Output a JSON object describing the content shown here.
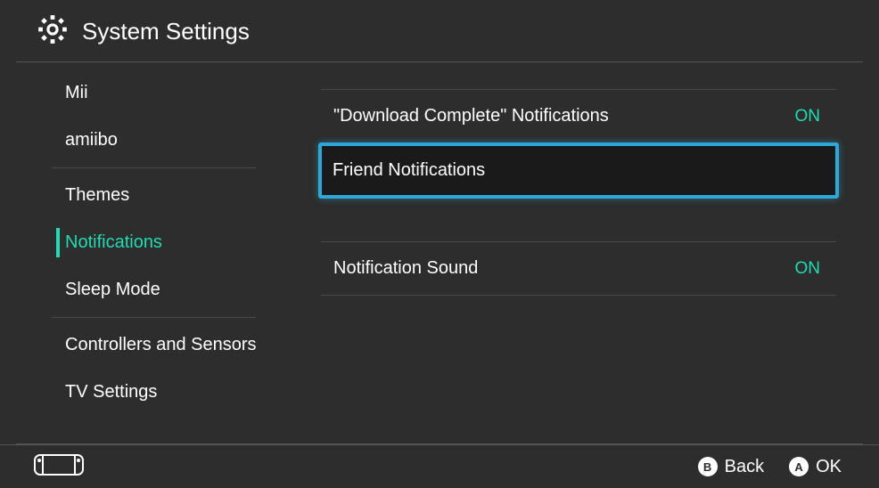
{
  "header": {
    "title": "System Settings"
  },
  "sidebar": {
    "groups": [
      {
        "items": [
          {
            "label": "Mii"
          },
          {
            "label": "amiibo"
          }
        ]
      },
      {
        "items": [
          {
            "label": "Themes"
          },
          {
            "label": "Notifications",
            "active": true
          },
          {
            "label": "Sleep Mode"
          }
        ]
      },
      {
        "items": [
          {
            "label": "Controllers and Sensors"
          },
          {
            "label": "TV Settings"
          }
        ]
      }
    ]
  },
  "settings": {
    "download_complete": {
      "label": "\"Download Complete\" Notifications",
      "value": "ON"
    },
    "friend": {
      "label": "Friend Notifications"
    },
    "sound": {
      "label": "Notification Sound",
      "value": "ON"
    }
  },
  "footer": {
    "back": {
      "button": "B",
      "label": "Back"
    },
    "ok": {
      "button": "A",
      "label": "OK"
    }
  }
}
